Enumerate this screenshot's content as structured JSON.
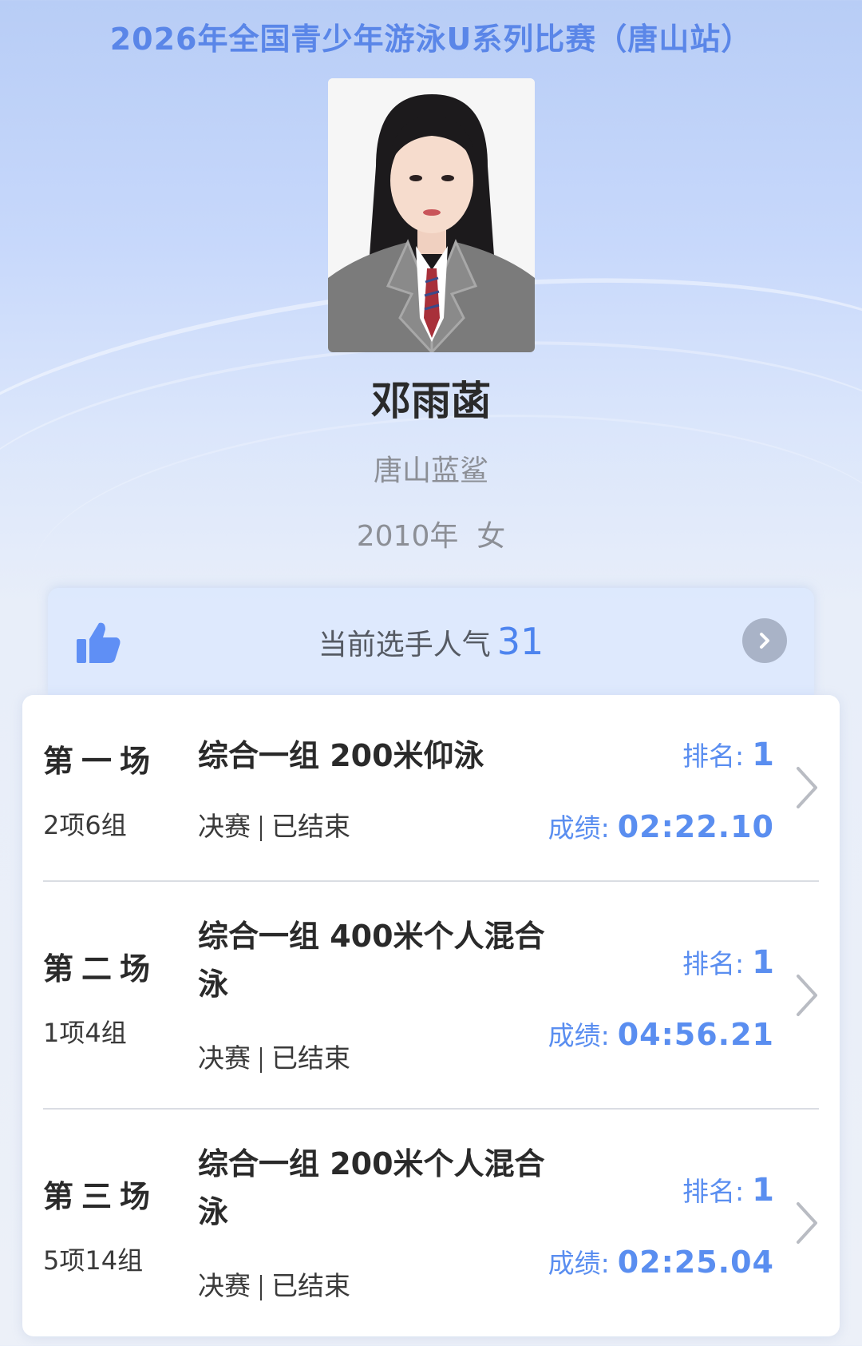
{
  "header": {
    "title": "2026年全国青少年游泳U系列比赛（唐山站）"
  },
  "athlete": {
    "name": "邓雨菡",
    "team": "唐山蓝鲨",
    "meta": "2010年  女"
  },
  "popularity": {
    "label": "当前选手人气",
    "count": "31",
    "icon": "thumbs-up-icon"
  },
  "sessions": [
    {
      "title": "第一场",
      "group": "2项6组",
      "event": "综合一组 200米仰泳",
      "stage": "决赛",
      "status": "已结束",
      "rank_label": "排名:",
      "rank": "1",
      "score_label": "成绩:",
      "score": "02:22.10"
    },
    {
      "title": "第二场",
      "group": "1项4组",
      "event": "综合一组 400米个人混合泳",
      "stage": "决赛",
      "status": "已结束",
      "rank_label": "排名:",
      "rank": "1",
      "score_label": "成绩:",
      "score": "04:56.21"
    },
    {
      "title": "第三场",
      "group": "5项14组",
      "event": "综合一组 200米个人混合泳",
      "stage": "决赛",
      "status": "已结束",
      "rank_label": "排名:",
      "rank": "1",
      "score_label": "成绩:",
      "score": "02:25.04"
    }
  ],
  "colors": {
    "accent": "#5a8ef0",
    "title": "#5a86e8"
  }
}
